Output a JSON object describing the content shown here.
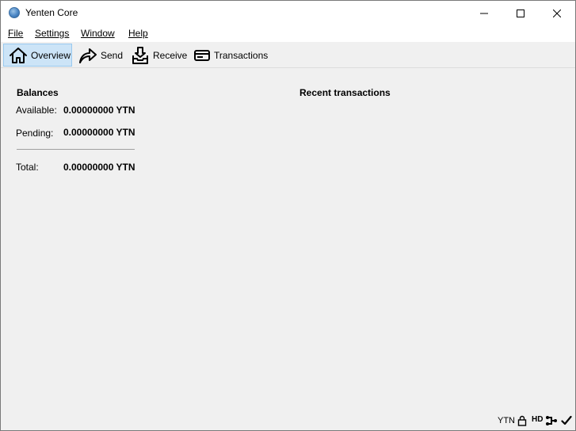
{
  "window": {
    "title": "Yenten Core"
  },
  "menu": {
    "items": [
      {
        "label": "File"
      },
      {
        "label": "Settings"
      },
      {
        "label": "Window"
      },
      {
        "label": "Help"
      }
    ]
  },
  "toolbar": {
    "items": [
      {
        "label": "Overview",
        "icon": "home-icon",
        "active": true
      },
      {
        "label": "Send",
        "icon": "send-arrow-icon",
        "active": false
      },
      {
        "label": "Receive",
        "icon": "receive-inbox-icon",
        "active": false
      },
      {
        "label": "Transactions",
        "icon": "card-icon",
        "active": false
      }
    ]
  },
  "balances": {
    "heading": "Balances",
    "available_label": "Available:",
    "available_value": "0.00000000 YTN",
    "pending_label": "Pending:",
    "pending_value": "0.00000000 YTN",
    "total_label": "Total:",
    "total_value": "0.00000000 YTN"
  },
  "recent": {
    "heading": "Recent transactions"
  },
  "statusbar": {
    "unit": "YTN",
    "hd": "HD",
    "icons": [
      "lock-icon",
      "hd-icon",
      "network-icon",
      "sync-check-icon"
    ]
  },
  "colors": {
    "active_tab_bg": "#cce4f7",
    "active_tab_border": "#99c9ef",
    "window_bg": "#f0f0f0"
  }
}
